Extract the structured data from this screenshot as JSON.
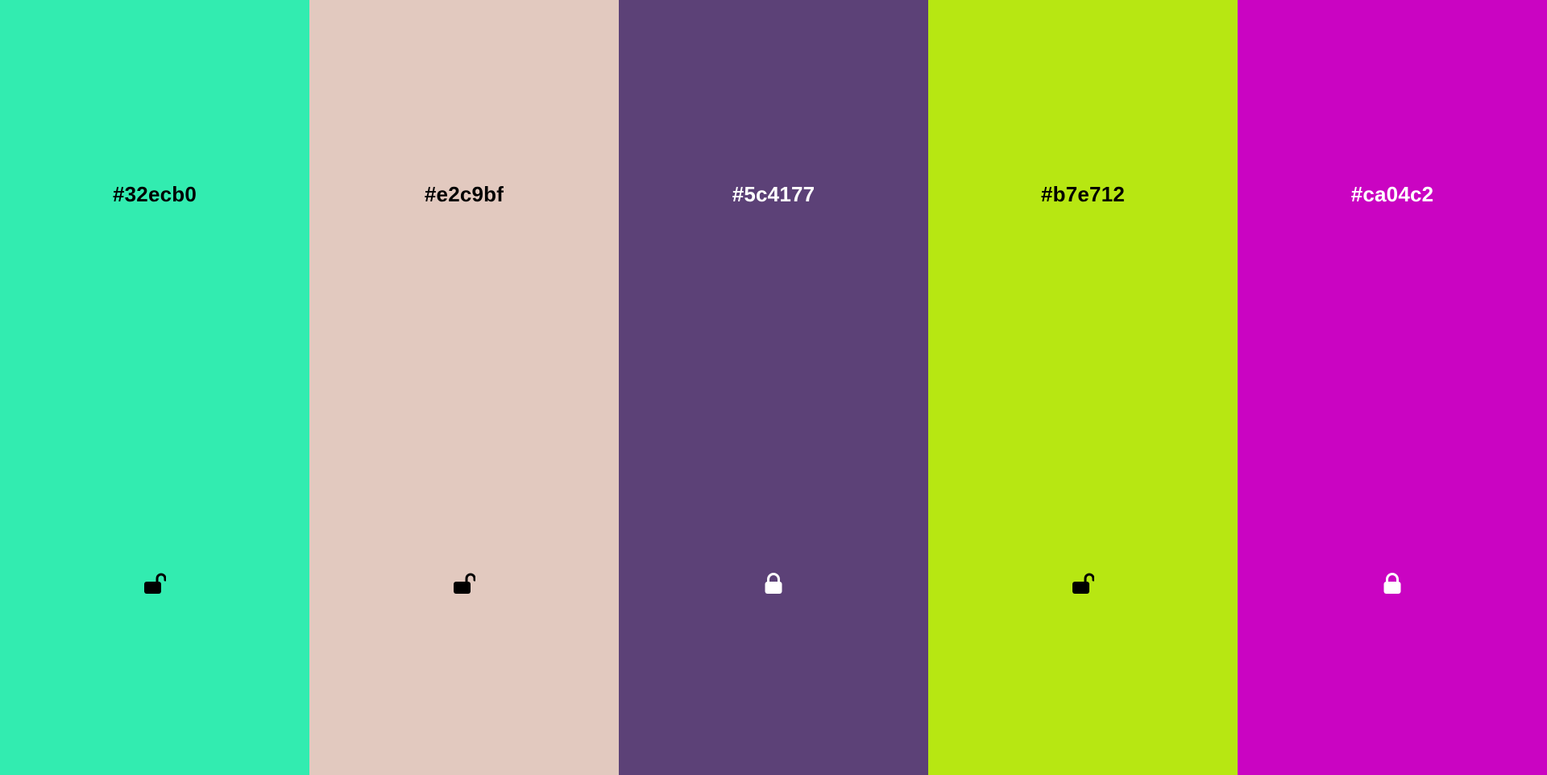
{
  "palette": {
    "colors": [
      {
        "hex": "#32ecb0",
        "background": "#32ecb0",
        "text_color": "#000000",
        "locked": false,
        "icon": "unlock-icon"
      },
      {
        "hex": "#e2c9bf",
        "background": "#e2c9bf",
        "text_color": "#000000",
        "locked": false,
        "icon": "unlock-icon"
      },
      {
        "hex": "#5c4177",
        "background": "#5c4177",
        "text_color": "#ffffff",
        "locked": true,
        "icon": "lock-icon"
      },
      {
        "hex": "#b7e712",
        "background": "#b7e712",
        "text_color": "#000000",
        "locked": false,
        "icon": "unlock-icon"
      },
      {
        "hex": "#ca04c2",
        "background": "#ca04c2",
        "text_color": "#ffffff",
        "locked": true,
        "icon": "lock-icon"
      }
    ]
  }
}
